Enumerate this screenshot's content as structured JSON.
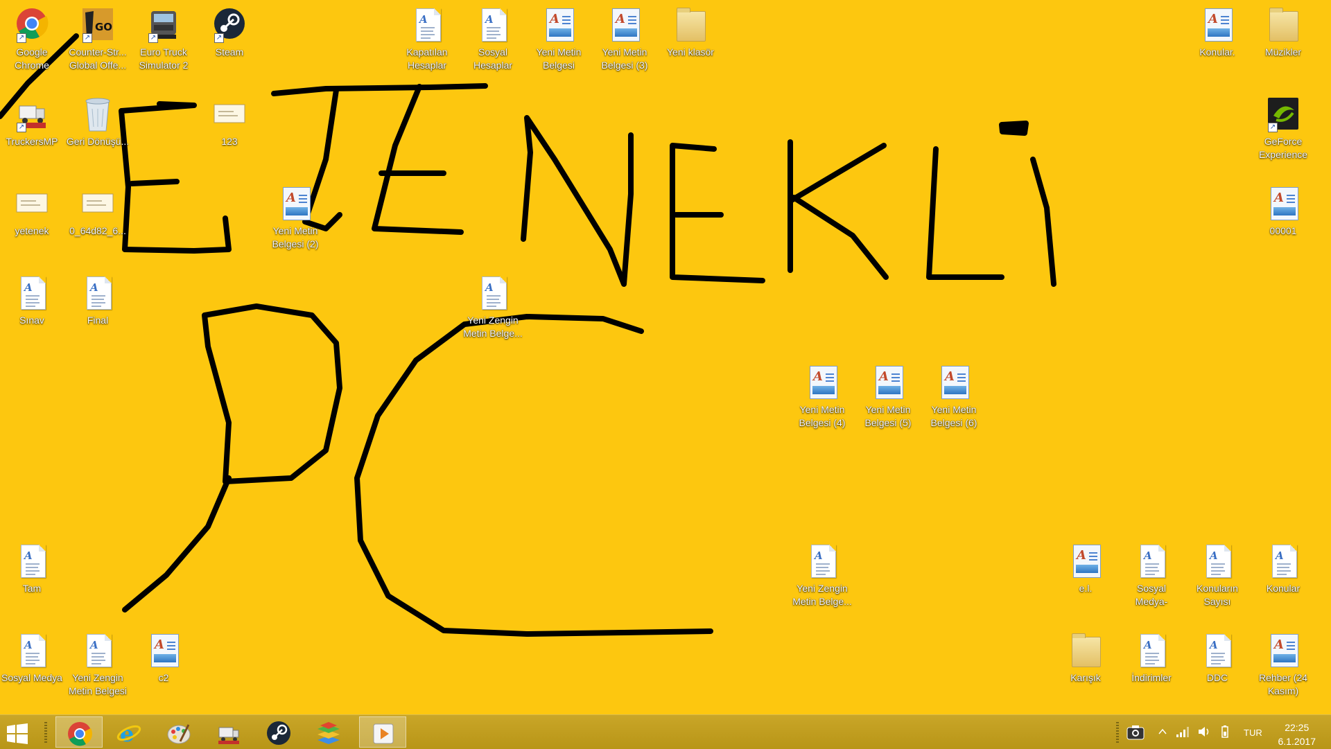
{
  "colors": {
    "desktop_bg": "#FDC70F",
    "taskbar_bg": "#B89517",
    "ink": "#000000"
  },
  "desktop": {
    "icons": [
      {
        "id": "google-chrome",
        "label": "Google Chrome",
        "type": "chrome"
      },
      {
        "id": "csgo",
        "label": "Counter-Str... Global Offe...",
        "type": "csgo"
      },
      {
        "id": "euro-truck",
        "label": "Euro Truck Simulator 2",
        "type": "truck"
      },
      {
        "id": "steam",
        "label": "Steam",
        "type": "steam"
      },
      {
        "id": "kapatilan-hesaplar",
        "label": "Kapatılan Hesaplar",
        "type": "doc"
      },
      {
        "id": "sosyal-hesaplar",
        "label": "Sosyal Hesaplar",
        "type": "doc"
      },
      {
        "id": "yeni-metin-belgesi",
        "label": "Yeni Metin Belgesi",
        "type": "wordpad"
      },
      {
        "id": "yeni-metin-belgesi-3",
        "label": "Yeni Metin Belgesi (3)",
        "type": "wordpad"
      },
      {
        "id": "yeni-klasor",
        "label": "Yeni klasör",
        "type": "folder"
      },
      {
        "id": "konular-top",
        "label": "Konular.",
        "type": "wordpad"
      },
      {
        "id": "muzikler",
        "label": "Müzikler",
        "type": "folder"
      },
      {
        "id": "truckersmp",
        "label": "TruckersMP",
        "type": "truckersmp"
      },
      {
        "id": "geri-donusum",
        "label": "Geri Dönüşü...",
        "type": "recycle"
      },
      {
        "id": "file-123",
        "label": "123",
        "type": "image"
      },
      {
        "id": "geforce",
        "label": "GeForce Experience",
        "type": "geforce"
      },
      {
        "id": "yetenek",
        "label": "yetenek",
        "type": "image"
      },
      {
        "id": "img-64d82",
        "label": "0_64d82_6...",
        "type": "image"
      },
      {
        "id": "yeni-metin-belgesi-2",
        "label": "Yeni Metin Belgesi (2)",
        "type": "wordpad"
      },
      {
        "id": "file-00001",
        "label": "00001",
        "type": "wordpad"
      },
      {
        "id": "sinav",
        "label": "Sınav",
        "type": "doc"
      },
      {
        "id": "final",
        "label": "Final",
        "type": "doc"
      },
      {
        "id": "yeni-zengin-1",
        "label": "Yeni Zengin Metin Belge...",
        "type": "doc"
      },
      {
        "id": "yeni-metin-belgesi-4",
        "label": "Yeni Metin Belgesi (4)",
        "type": "wordpad"
      },
      {
        "id": "yeni-metin-belgesi-5",
        "label": "Yeni Metin Belgesi (5)",
        "type": "wordpad"
      },
      {
        "id": "yeni-metin-belgesi-6",
        "label": "Yeni Metin Belgesi (6)",
        "type": "wordpad"
      },
      {
        "id": "tam",
        "label": "Tam",
        "type": "doc"
      },
      {
        "id": "yeni-zengin-2",
        "label": "Yeni Zengin Metin Belge...",
        "type": "doc"
      },
      {
        "id": "el",
        "label": "e.l.",
        "type": "wordpad"
      },
      {
        "id": "sosyal-medya-right",
        "label": "Sosyal Medya-",
        "type": "doc"
      },
      {
        "id": "konularin-sayisi",
        "label": "Konuların Sayısı",
        "type": "doc"
      },
      {
        "id": "konular-bottom",
        "label": "Konular",
        "type": "doc"
      },
      {
        "id": "sosyal-medya",
        "label": "Sosyal Medya",
        "type": "doc"
      },
      {
        "id": "yeni-zengin-3",
        "label": "Yeni Zengin Metin Belgesi",
        "type": "doc"
      },
      {
        "id": "c2",
        "label": "c2",
        "type": "wordpad"
      },
      {
        "id": "karisik",
        "label": "Karışık",
        "type": "folder"
      },
      {
        "id": "indirimler",
        "label": "İndirimler",
        "type": "doc"
      },
      {
        "id": "ddc",
        "label": "DDC",
        "type": "doc"
      },
      {
        "id": "rehber",
        "label": "Rehber (24 Kasım)",
        "type": "wordpad"
      }
    ]
  },
  "taskbar": {
    "start_icon": "windows-logo-icon",
    "apps": [
      {
        "id": "chrome",
        "icon": "chrome-icon",
        "active": true
      },
      {
        "id": "ie",
        "icon": "internet-explorer-icon",
        "active": false
      },
      {
        "id": "paint",
        "icon": "paint-icon",
        "active": false
      },
      {
        "id": "truckersmp",
        "icon": "truckersmp-icon",
        "active": false
      },
      {
        "id": "steam",
        "icon": "steam-icon",
        "active": false
      },
      {
        "id": "bluestacks",
        "icon": "bluestacks-icon",
        "active": false
      },
      {
        "id": "media",
        "icon": "media-player-icon",
        "active": true
      }
    ],
    "tray": {
      "language": "TUR",
      "time": "22:25",
      "date": "6.1.2017"
    }
  }
}
